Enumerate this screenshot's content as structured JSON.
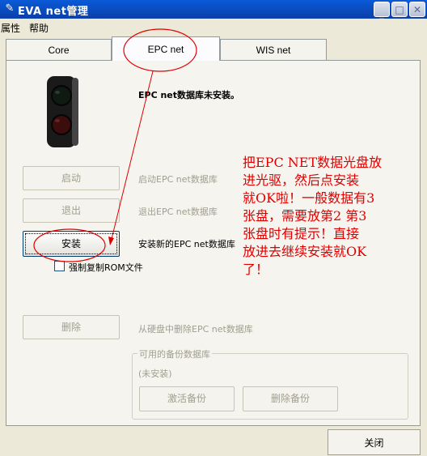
{
  "window": {
    "title": "EVA net管理"
  },
  "menu": [
    "属性",
    "帮助"
  ],
  "tabs": [
    {
      "label": "Core",
      "active": false
    },
    {
      "label": "EPC net",
      "active": true
    },
    {
      "label": "WIS net",
      "active": false
    }
  ],
  "status": {
    "message": "EPC net数据库未安装。"
  },
  "actions": {
    "start": {
      "label": "启动",
      "desc": "启动EPC net数据库",
      "enabled": false
    },
    "exit": {
      "label": "退出",
      "desc": "退出EPC net数据库",
      "enabled": false
    },
    "install": {
      "label": "安装",
      "desc": "安装新的EPC net数据库",
      "enabled": true
    },
    "delete": {
      "label": "删除",
      "desc": "从硬盘中删除EPC net数据库",
      "enabled": false
    }
  },
  "force_copy": {
    "label": "强制复制ROM文件",
    "checked": false
  },
  "backup": {
    "legend": "可用的备份数据库",
    "state": "(未安装)",
    "activate_label": "激活备份",
    "delete_label": "删除备份"
  },
  "annotation": {
    "lines": [
      "把EPC NET数据光盘放",
      "进光驱，然后点安装",
      "就OK啦！一般数据有3",
      "张盘，需要放第2 第3",
      "张盘时有提示！直接",
      "放进去继续安装就OK",
      "了！"
    ],
    "color": "#e00000"
  },
  "footer": {
    "close_label": "关闭"
  }
}
